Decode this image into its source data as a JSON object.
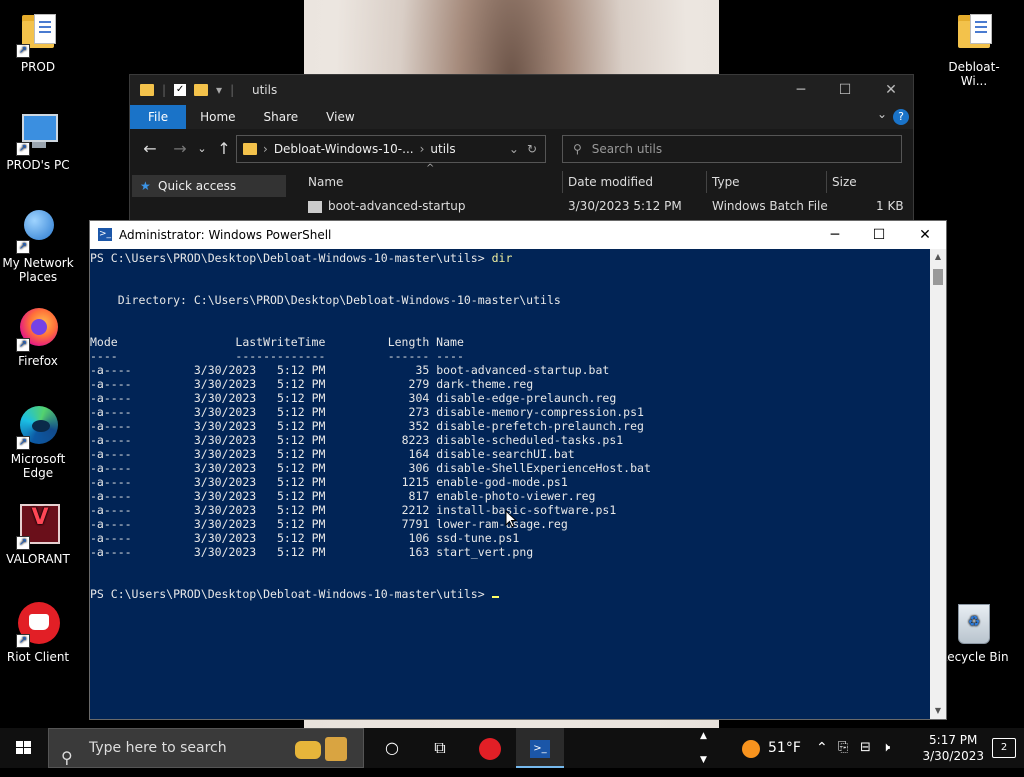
{
  "desktop": {
    "icons": [
      {
        "label": "PROD"
      },
      {
        "label": "PROD's PC"
      },
      {
        "label": "My Network Places"
      },
      {
        "label": "Firefox"
      },
      {
        "label": "Microsoft Edge"
      },
      {
        "label": "VALORANT"
      },
      {
        "label": "Riot Client"
      },
      {
        "label": "Debloat-Wi..."
      },
      {
        "label": "Recycle Bin"
      }
    ]
  },
  "explorer": {
    "title": "utils",
    "tabs": [
      "File",
      "Home",
      "Share",
      "View"
    ],
    "help_label": "?",
    "address": [
      "Debloat-Windows-10-...",
      "utils"
    ],
    "search_placeholder": "Search utils",
    "quick_access": "Quick access",
    "columns": [
      "Name",
      "Date modified",
      "Type",
      "Size"
    ],
    "row": {
      "name": "boot-advanced-startup",
      "date": "3/30/2023 5:12 PM",
      "type": "Windows Batch File",
      "size": "1 KB"
    }
  },
  "powershell": {
    "title": "Administrator: Windows PowerShell",
    "prompt": "PS C:\\Users\\PROD\\Desktop\\Debloat-Windows-10-master\\utils>",
    "command": "dir",
    "directory_line": "    Directory: C:\\Users\\PROD\\Desktop\\Debloat-Windows-10-master\\utils",
    "header": "Mode                 LastWriteTime         Length Name",
    "separator": "----                 -------------         ------ ----",
    "files": [
      {
        "mode": "-a----",
        "date": "3/30/2023",
        "time": "5:12 PM",
        "length": "35",
        "name": "boot-advanced-startup.bat"
      },
      {
        "mode": "-a----",
        "date": "3/30/2023",
        "time": "5:12 PM",
        "length": "279",
        "name": "dark-theme.reg"
      },
      {
        "mode": "-a----",
        "date": "3/30/2023",
        "time": "5:12 PM",
        "length": "304",
        "name": "disable-edge-prelaunch.reg"
      },
      {
        "mode": "-a----",
        "date": "3/30/2023",
        "time": "5:12 PM",
        "length": "273",
        "name": "disable-memory-compression.ps1"
      },
      {
        "mode": "-a----",
        "date": "3/30/2023",
        "time": "5:12 PM",
        "length": "352",
        "name": "disable-prefetch-prelaunch.reg"
      },
      {
        "mode": "-a----",
        "date": "3/30/2023",
        "time": "5:12 PM",
        "length": "8223",
        "name": "disable-scheduled-tasks.ps1"
      },
      {
        "mode": "-a----",
        "date": "3/30/2023",
        "time": "5:12 PM",
        "length": "164",
        "name": "disable-searchUI.bat"
      },
      {
        "mode": "-a----",
        "date": "3/30/2023",
        "time": "5:12 PM",
        "length": "306",
        "name": "disable-ShellExperienceHost.bat"
      },
      {
        "mode": "-a----",
        "date": "3/30/2023",
        "time": "5:12 PM",
        "length": "1215",
        "name": "enable-god-mode.ps1"
      },
      {
        "mode": "-a----",
        "date": "3/30/2023",
        "time": "5:12 PM",
        "length": "817",
        "name": "enable-photo-viewer.reg"
      },
      {
        "mode": "-a----",
        "date": "3/30/2023",
        "time": "5:12 PM",
        "length": "2212",
        "name": "install-basic-software.ps1"
      },
      {
        "mode": "-a----",
        "date": "3/30/2023",
        "time": "5:12 PM",
        "length": "7791",
        "name": "lower-ram-usage.reg"
      },
      {
        "mode": "-a----",
        "date": "3/30/2023",
        "time": "5:12 PM",
        "length": "106",
        "name": "ssd-tune.ps1"
      },
      {
        "mode": "-a----",
        "date": "3/30/2023",
        "time": "5:12 PM",
        "length": "163",
        "name": "start_vert.png"
      }
    ]
  },
  "taskbar": {
    "search_placeholder": "Type here to search",
    "weather": "51°F",
    "time": "5:17 PM",
    "date": "3/30/2023",
    "notification_count": "2"
  },
  "colors": {
    "ps_background": "#012456",
    "accent": "#1a73c8"
  }
}
